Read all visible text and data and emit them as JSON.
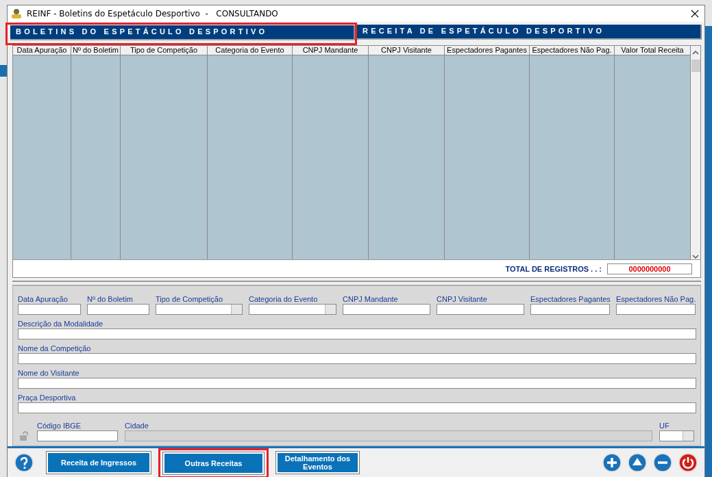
{
  "window": {
    "title": "REINF - Boletins do Espetáculo Desportivo  -   CONSULTANDO"
  },
  "section_tabs": [
    {
      "label": "BOLETINS DO ESPETÁCULO DESPORTIVO",
      "highlighted": true
    },
    {
      "label": "RECEITA DE ESPETÁCULO DESPORTIVO",
      "highlighted": false
    }
  ],
  "table": {
    "columns": [
      "Data Apuração",
      "Nº do Boletim",
      "Tipo de Competição",
      "Categoria do Evento",
      "CNPJ Mandante",
      "CNPJ Visitante",
      "Espectadores Pagantes",
      "Espectadores Não Pag.",
      "Valor Total Receita"
    ]
  },
  "total": {
    "label": "TOTAL DE REGISTROS . . :",
    "value": "0000000000"
  },
  "form": {
    "top_fields": [
      {
        "label": "Data Apuração",
        "kind": "text"
      },
      {
        "label": "Nº do Boletim",
        "kind": "text"
      },
      {
        "label": "Tipo de Competição",
        "kind": "select"
      },
      {
        "label": "Categoria do Evento",
        "kind": "select"
      },
      {
        "label": "CNPJ Mandante",
        "kind": "text"
      },
      {
        "label": "CNPJ Visitante",
        "kind": "text"
      },
      {
        "label": "Espectadores Pagantes",
        "kind": "text"
      },
      {
        "label": "Espectadores Não Pag.",
        "kind": "text"
      }
    ],
    "wide_fields": [
      {
        "label": "Descrição da Modalidade"
      },
      {
        "label": "Nome da Competição"
      },
      {
        "label": "Nome do Visitante"
      },
      {
        "label": "Praça Desportiva"
      }
    ],
    "location_fields": [
      {
        "label": "Código IBGE",
        "kind": "text"
      },
      {
        "label": "Cidade",
        "kind": "disabled"
      },
      {
        "label": "UF",
        "kind": "select"
      }
    ]
  },
  "buttons": [
    {
      "label": "Receita de Ingressos",
      "highlighted": false
    },
    {
      "label": "Outras Receitas",
      "highlighted": true
    },
    {
      "label": "Detalhamento dos Eventos",
      "highlighted": false
    }
  ],
  "round_buttons": [
    {
      "kind": "add"
    },
    {
      "kind": "up"
    },
    {
      "kind": "remove"
    },
    {
      "kind": "power"
    }
  ]
}
